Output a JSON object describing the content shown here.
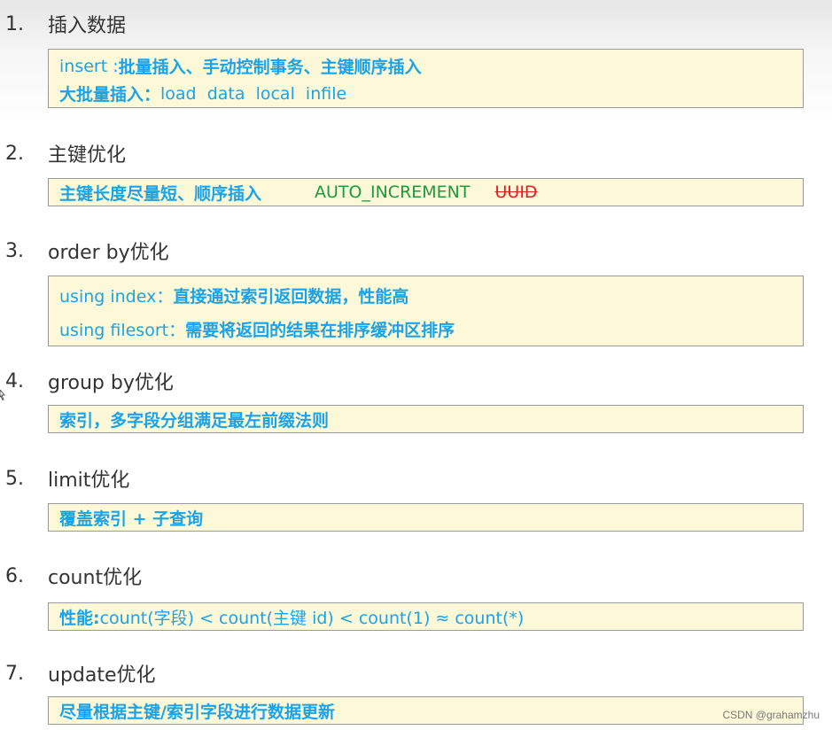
{
  "sections": [
    {
      "number": "1.",
      "title": "插入数据",
      "lines": [
        {
          "prefix": "insert : ",
          "text": "批量插入、手动控制事务、主键顺序插入"
        },
        {
          "prefix": "大批量插入：",
          "text": "load  data  local  infile"
        }
      ]
    },
    {
      "number": "2.",
      "title": "主键优化",
      "lines": [
        {
          "text": "主键长度尽量短、顺序插入",
          "green": "AUTO_INCREMENT",
          "strike": "UUID"
        }
      ]
    },
    {
      "number": "3.",
      "title": "order by优化",
      "lines": [
        {
          "prefix": "using index：",
          "text": "直接通过索引返回数据，性能高"
        },
        {
          "prefix": "using filesort：",
          "text": "需要将返回的结果在排序缓冲区排序"
        }
      ]
    },
    {
      "number": "4.",
      "title": "group by优化",
      "lines": [
        {
          "text": "索引，多字段分组满足最左前缀法则"
        }
      ]
    },
    {
      "number": "5.",
      "title": "limit优化",
      "lines": [
        {
          "text": "覆盖索引 + 子查询"
        }
      ]
    },
    {
      "number": "6.",
      "title": "count优化",
      "lines": [
        {
          "prefix": "性能: ",
          "text": "count(字段) < count(主键 id) < count(1) ≈ count(*)"
        }
      ]
    },
    {
      "number": "7.",
      "title": "update优化",
      "lines": [
        {
          "text": "尽量根据主键/索引字段进行数据更新"
        }
      ]
    }
  ],
  "watermark": "CSDN @grahamzhu",
  "colors": {
    "heading": "#333333",
    "box_text": "#1aa3e8",
    "box_bg": "#fdf8d8",
    "green": "#1c9a3c",
    "red": "#e02020"
  }
}
